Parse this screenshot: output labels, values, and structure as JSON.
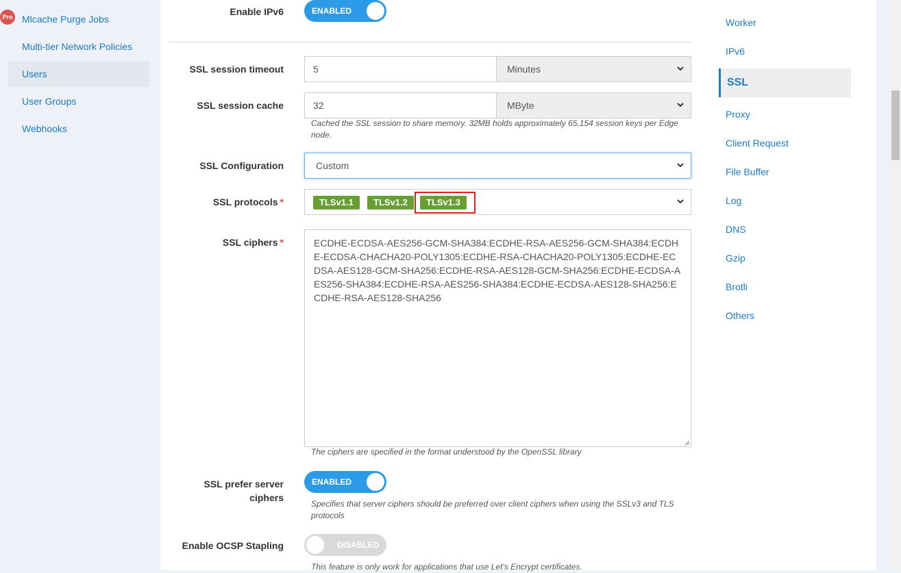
{
  "sidebar": {
    "pro_badge": "Pro",
    "items": [
      {
        "label": "Mlcache Purge Jobs"
      },
      {
        "label": "Multi-tier Network Policies"
      },
      {
        "label": "Users"
      },
      {
        "label": "User Groups"
      },
      {
        "label": "Webhooks"
      }
    ]
  },
  "form": {
    "ipv6": {
      "label": "Enable IPv6",
      "state": "ENABLED"
    },
    "session_timeout": {
      "label": "SSL session timeout",
      "value": "5",
      "unit": "Minutes"
    },
    "session_cache": {
      "label": "SSL session cache",
      "value": "32",
      "unit": "MByte",
      "help_line1": "Cached the SSL session to share memory. 32MB holds approximately 65,154 session keys per Edge",
      "help_line2": "node."
    },
    "ssl_config": {
      "label": "SSL Configuration",
      "value": "Custom"
    },
    "ssl_protocols": {
      "label": "SSL protocols",
      "required_mark": "*",
      "tags": [
        "TLSv1.1",
        "TLSv1.2",
        "TLSv1.3"
      ]
    },
    "ssl_ciphers": {
      "label": "SSL ciphers",
      "required_mark": "*",
      "value": "ECDHE-ECDSA-AES256-GCM-SHA384:ECDHE-RSA-AES256-GCM-SHA384:ECDHE-ECDSA-CHACHA20-POLY1305:ECDHE-RSA-CHACHA20-POLY1305:ECDHE-ECDSA-AES128-GCM-SHA256:ECDHE-RSA-AES128-GCM-SHA256:ECDHE-ECDSA-AES256-SHA384:ECDHE-RSA-AES256-SHA384:ECDHE-ECDSA-AES128-SHA256:ECDHE-RSA-AES128-SHA256",
      "help": "The ciphers are specified in the format understood by the OpenSSL library"
    },
    "prefer_server": {
      "label_line1": "SSL prefer server",
      "label_line2": "ciphers",
      "state": "ENABLED",
      "help_line1": "Specifies that server ciphers should be preferred over client ciphers when using the SSLv3 and TLS",
      "help_line2": "protocols"
    },
    "ocsp": {
      "label": "Enable OCSP Stapling",
      "state": "DISABLED",
      "help": "This feature is only work for applications that use Let's Encrypt certificates."
    }
  },
  "right_nav": {
    "items": [
      {
        "label": "Worker"
      },
      {
        "label": "IPv6"
      },
      {
        "label": "SSL"
      },
      {
        "label": "Proxy"
      },
      {
        "label": "Client Request"
      },
      {
        "label": "File Buffer"
      },
      {
        "label": "Log"
      },
      {
        "label": "DNS"
      },
      {
        "label": "Gzip"
      },
      {
        "label": "Brotli"
      },
      {
        "label": "Others"
      }
    ]
  },
  "colors": {
    "link": "#1a7bc4",
    "toggle_on": "#2b9be8",
    "tag_green": "#66a032",
    "highlight_red": "#e0201b",
    "required": "#d9534f"
  }
}
